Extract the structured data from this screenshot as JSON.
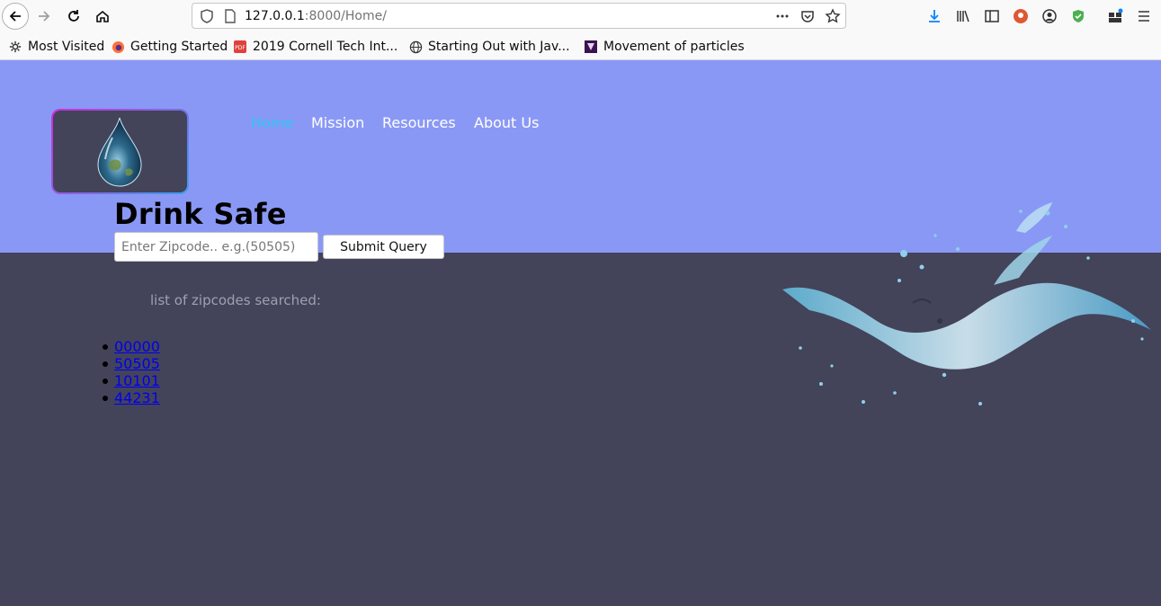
{
  "browser": {
    "url_host": "127.0.0.1",
    "url_rest": ":8000/Home/",
    "bookmarks": [
      {
        "label": "Most Visited",
        "icon": "gear-icon"
      },
      {
        "label": "Getting Started",
        "icon": "firefox-icon"
      },
      {
        "label": "2019 Cornell Tech Int...",
        "icon": "pdf-icon"
      },
      {
        "label": "Starting Out with Jav...",
        "icon": "globe-icon"
      },
      {
        "label": "Movement of particles",
        "icon": "bookmark-icon"
      }
    ]
  },
  "site": {
    "nav": [
      {
        "label": "Home",
        "active": true
      },
      {
        "label": "Mission",
        "active": false
      },
      {
        "label": "Resources",
        "active": false
      },
      {
        "label": "About Us",
        "active": false
      }
    ],
    "title": "Drink Safe",
    "search": {
      "placeholder": "Enter Zipcode.. e.g.(50505)",
      "value": ""
    },
    "submit_label": "Submit Query",
    "list_label": "list of zipcodes searched:",
    "zipcodes": [
      "00000",
      "50505",
      "10101",
      "44231"
    ]
  },
  "colors": {
    "header_band": "#8a98f5",
    "page_bg": "#43435a",
    "nav_active": "#2ec6f2",
    "link": "#0000ee"
  }
}
